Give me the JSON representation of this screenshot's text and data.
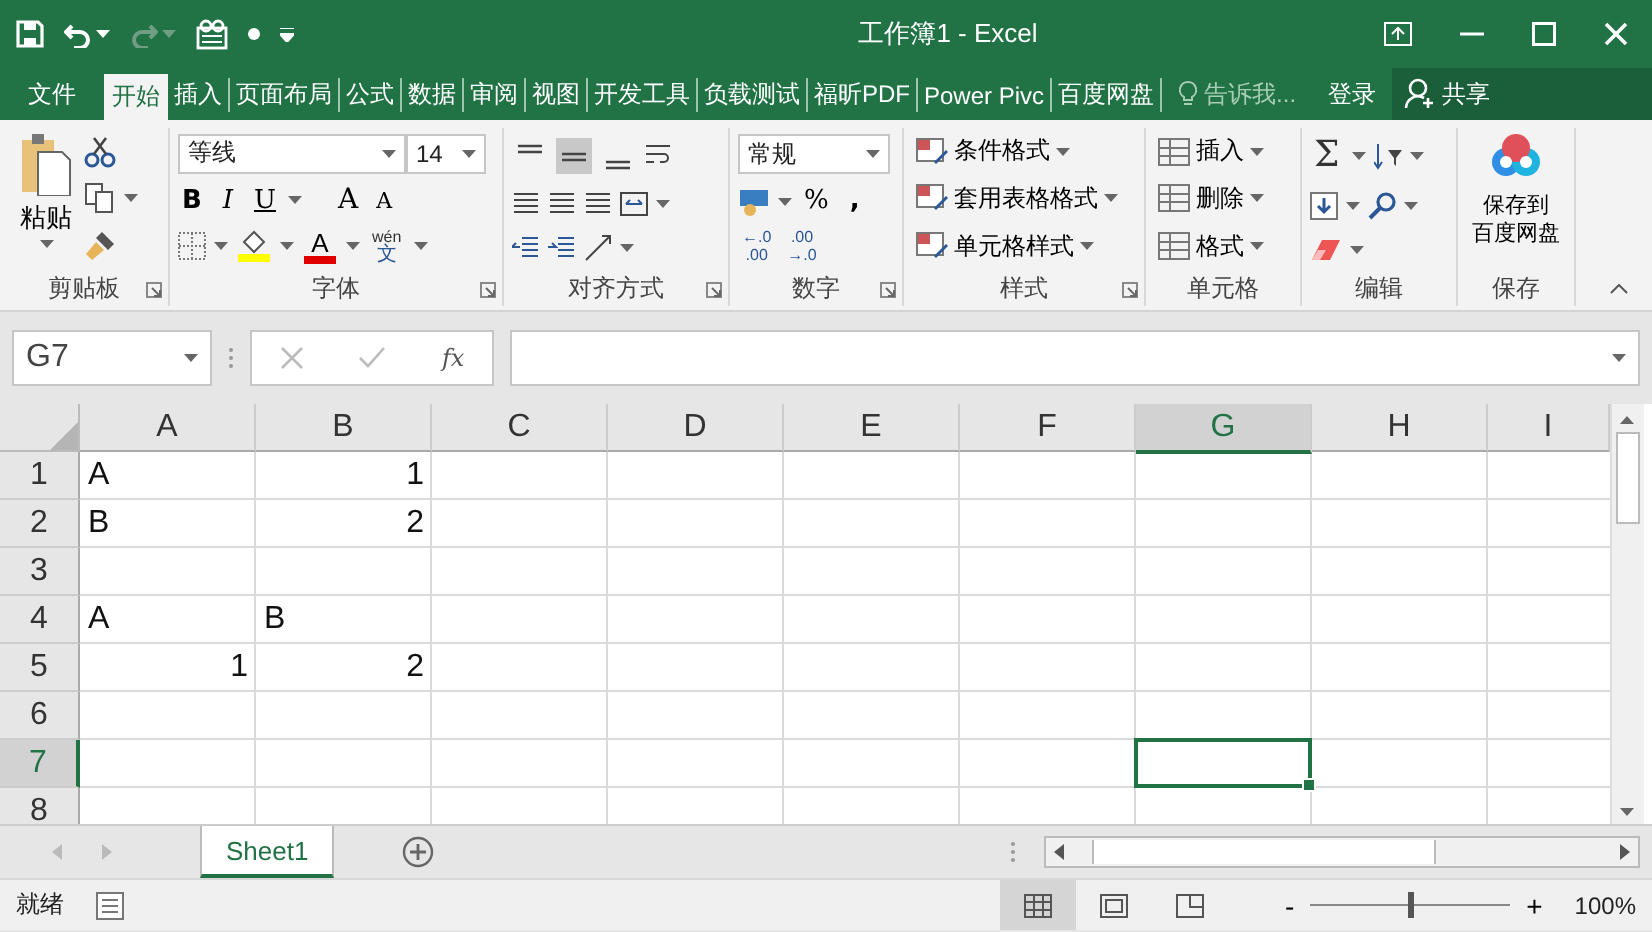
{
  "window": {
    "title": "工作簿1 - Excel"
  },
  "tabs": [
    {
      "label": "文件",
      "selected": false
    },
    {
      "label": "开始",
      "selected": true
    },
    {
      "label": "插入",
      "selected": false
    },
    {
      "label": "页面布局",
      "selected": false
    },
    {
      "label": "公式",
      "selected": false
    },
    {
      "label": "数据",
      "selected": false
    },
    {
      "label": "审阅",
      "selected": false
    },
    {
      "label": "视图",
      "selected": false
    },
    {
      "label": "开发工具",
      "selected": false
    },
    {
      "label": "负载测试",
      "selected": false
    },
    {
      "label": "福昕PDF",
      "selected": false
    },
    {
      "label": "Power Pivc",
      "selected": false
    },
    {
      "label": "百度网盘",
      "selected": false
    }
  ],
  "tell_me": {
    "placeholder": "告诉我..."
  },
  "sign_in": "登录",
  "share": "共享",
  "ribbon": {
    "clipboard": {
      "paste": "粘贴",
      "label": "剪贴板"
    },
    "font": {
      "font_name": "等线",
      "font_size": "14",
      "buttons": [
        {
          "kind": "bold",
          "label": "B"
        },
        {
          "kind": "italic",
          "label": "I"
        },
        {
          "kind": "underline",
          "label": "U"
        },
        {
          "kind": "grow",
          "label": "A"
        },
        {
          "kind": "shrink",
          "label": "A"
        }
      ],
      "fill_color": {
        "color": "#ffff00"
      },
      "font_color": {
        "label": "A",
        "color": "#e00000"
      },
      "phonetic": {
        "top": "wén",
        "bottom": "文"
      },
      "label": "字体"
    },
    "alignment": {
      "label": "对齐方式"
    },
    "number": {
      "format": "常规",
      "percent": "%",
      "comma": ",",
      "decimals": [
        {
          "top": "←.0",
          "bottom": ".00"
        },
        {
          "top": ".00",
          "bottom": "→.0"
        }
      ],
      "label": "数字"
    },
    "styles": {
      "items": [
        "条件格式",
        "套用表格格式",
        "单元格样式"
      ],
      "label": "样式"
    },
    "cells": {
      "items": [
        "插入",
        "删除",
        "格式"
      ],
      "label": "单元格"
    },
    "editing": {
      "sum": "Σ",
      "label": "编辑"
    },
    "save": {
      "lines": [
        "保存到",
        "百度网盘"
      ],
      "label": "保存"
    }
  },
  "formula_bar": {
    "name_box": "G7",
    "fx": "fx"
  },
  "columns": [
    {
      "label": "A",
      "selected": false
    },
    {
      "label": "B",
      "selected": false
    },
    {
      "label": "C",
      "selected": false
    },
    {
      "label": "D",
      "selected": false
    },
    {
      "label": "E",
      "selected": false
    },
    {
      "label": "F",
      "selected": false
    },
    {
      "label": "G",
      "selected": true
    },
    {
      "label": "H",
      "selected": false
    },
    {
      "label": "I",
      "selected": false
    }
  ],
  "rows": [
    {
      "label": "1",
      "selected": false,
      "cells": [
        {
          "text": "A",
          "kind": "text"
        },
        {
          "text": "1",
          "kind": "number"
        }
      ]
    },
    {
      "label": "2",
      "selected": false,
      "cells": [
        {
          "text": "B",
          "kind": "text"
        },
        {
          "text": "2",
          "kind": "number"
        }
      ]
    },
    {
      "label": "3",
      "selected": false
    },
    {
      "label": "4",
      "selected": false,
      "cells": [
        {
          "text": "A",
          "kind": "text"
        },
        {
          "text": "B",
          "kind": "text"
        }
      ]
    },
    {
      "label": "5",
      "selected": false,
      "cells": [
        {
          "text": "1",
          "kind": "number"
        },
        {
          "text": "2",
          "kind": "number"
        }
      ]
    },
    {
      "label": "6",
      "selected": false
    },
    {
      "label": "7",
      "selected": true
    },
    {
      "label": "8",
      "selected": false
    }
  ],
  "sheets": [
    {
      "name": "Sheet1",
      "selected": true
    }
  ],
  "status_bar": {
    "status": "就绪",
    "zoom": {
      "minus": "-",
      "plus": "+",
      "level": 0.5,
      "reading": "100%"
    }
  }
}
